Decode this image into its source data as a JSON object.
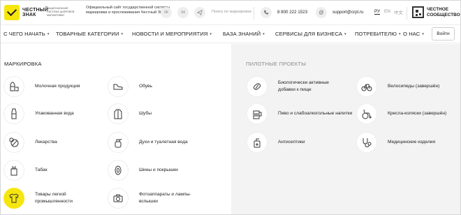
{
  "header": {
    "logo_line1": "ЧЕСТНЫЙ",
    "logo_line2": "ЗНАК",
    "logo_sub": "НАЦИОНАЛЬНАЯ СИСТЕМА ЦИФРОВОЙ МАРКИРОВКИ",
    "tagline": "Официальный сайт государственной системы маркировки и прослеживания Честный ЗНАК",
    "social": [
      "vk-icon",
      "ok-icon",
      "telegram-icon"
    ],
    "search_placeholder": "Поиск по маркировке",
    "phone": "8 800 222 1523",
    "email": "support@crpt.ru",
    "languages": [
      "РУ",
      "EN",
      "中文"
    ],
    "active_language": "РУ",
    "partner_line1": "ЧЕСТНОЕ",
    "partner_line2": "СООБЩЕСТВО"
  },
  "nav": {
    "items": [
      "С ЧЕГО НАЧАТЬ",
      "ТОВАРНЫЕ КАТЕГОРИИ",
      "НОВОСТИ И МЕРОПРИЯТИЯ",
      "БАЗА ЗНАНИЙ",
      "СЕРВИСЫ ДЛЯ БИЗНЕСА",
      "ПОТРЕБИТЕЛЮ",
      "О НАС"
    ],
    "login": "Войти"
  },
  "marking": {
    "title": "МАРКИРОВКА",
    "left_column": [
      {
        "label": "Молочная продукция",
        "icon": "milk-icon"
      },
      {
        "label": "Упакованная вода",
        "icon": "water-bottle-icon"
      },
      {
        "label": "Лекарства",
        "icon": "medicine-icon"
      },
      {
        "label": "Табак",
        "icon": "tobacco-icon"
      },
      {
        "label": "Товары легкой промышленности",
        "icon": "tshirt-icon",
        "highlighted": true
      }
    ],
    "right_column": [
      {
        "label": "Обувь",
        "icon": "shoe-icon"
      },
      {
        "label": "Шубы",
        "icon": "fur-coat-icon"
      },
      {
        "label": "Духи и туалетная вода",
        "icon": "perfume-icon"
      },
      {
        "label": "Шины и покрышки",
        "icon": "tire-icon"
      },
      {
        "label": "Фотоаппараты и лампы-вспышки",
        "icon": "camera-icon"
      }
    ]
  },
  "pilot": {
    "title": "ПИЛОТНЫЕ ПРОЕКТЫ",
    "left_column": [
      {
        "label": "Биологически активные добавки к пище",
        "icon": "supplement-icon"
      },
      {
        "label": "Пиво и слабоалкогольные напитки",
        "icon": "beer-icon"
      },
      {
        "label": "Антисептики",
        "icon": "antiseptic-icon"
      }
    ],
    "right_column": [
      {
        "label": "Велосипеды (завершён)",
        "icon": "bicycle-icon"
      },
      {
        "label": "Кресла-коляски (завершён)",
        "icon": "wheelchair-icon"
      },
      {
        "label": "Медицинские изделия",
        "icon": "stethoscope-icon"
      }
    ]
  },
  "colors": {
    "accent": "#f6e60e",
    "panel_bg": "#f3f3f3"
  }
}
